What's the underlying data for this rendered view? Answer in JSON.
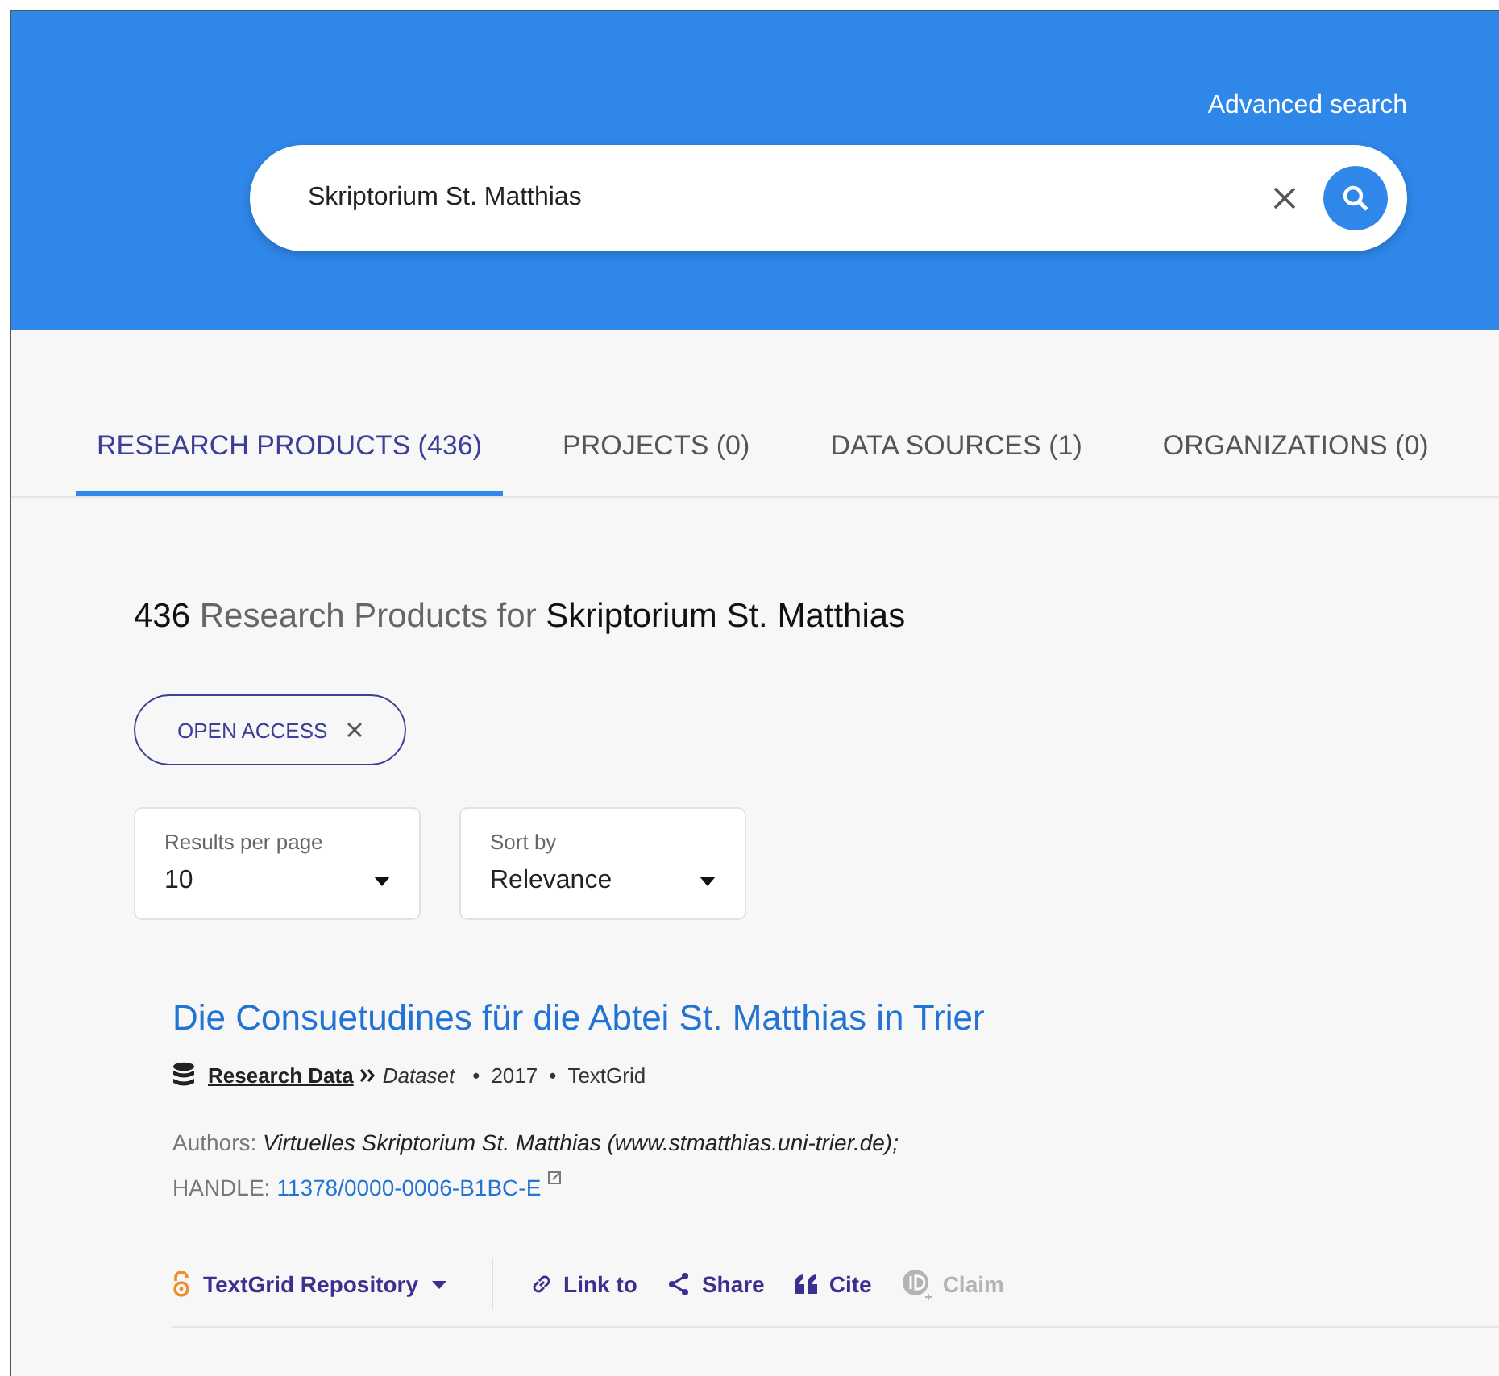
{
  "header": {
    "advanced_search": "Advanced search",
    "search": {
      "value": "Skriptorium St. Matthias"
    }
  },
  "tabs": [
    {
      "label": "RESEARCH PRODUCTS (436)",
      "selected": true
    },
    {
      "label": "PROJECTS (0)",
      "selected": false
    },
    {
      "label": "DATA SOURCES (1)",
      "selected": false
    },
    {
      "label": "ORGANIZATIONS (0)",
      "selected": false
    }
  ],
  "results_heading": {
    "count": "436",
    "text": "Research Products for",
    "query": "Skriptorium St. Matthias"
  },
  "filters": [
    {
      "label": "OPEN ACCESS"
    }
  ],
  "selects": [
    {
      "label": "Results per page",
      "value": "10"
    },
    {
      "label": "Sort by",
      "value": "Relevance"
    }
  ],
  "results": [
    {
      "title": "Die Consuetudines für die Abtei St. Matthias in Trier",
      "type": "Research Data",
      "subtype": "Dataset",
      "separator": "•",
      "meta": [
        "2017",
        "TextGrid"
      ],
      "authors_label": "Authors:",
      "authors": "Virtuelles Skriptorium St. Matthias (www.stmatthias.uni-trier.de);",
      "handle_label": "HANDLE:",
      "handle": "11378/0000-0006-B1BC-E",
      "repository": "TextGrid Repository",
      "actions": [
        {
          "kind": "link",
          "label": "Link to",
          "disabled": false
        },
        {
          "kind": "share",
          "label": "Share",
          "disabled": false
        },
        {
          "kind": "cite",
          "label": "Cite",
          "disabled": false
        },
        {
          "kind": "claim",
          "label": "Claim",
          "disabled": true
        }
      ]
    }
  ]
}
